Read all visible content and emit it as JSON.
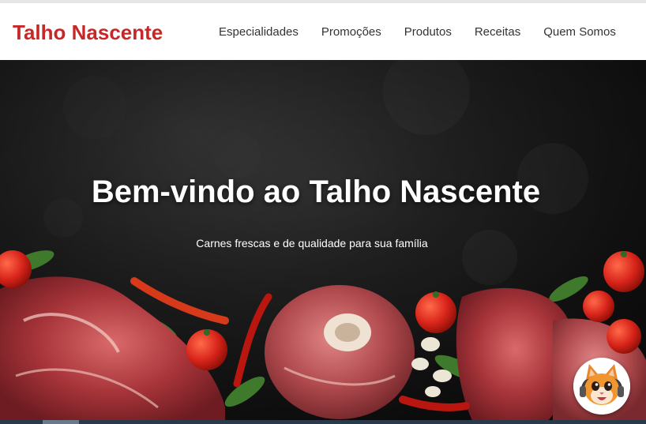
{
  "brand": {
    "name": "Talho Nascente",
    "color": "#c62828"
  },
  "nav": {
    "items": [
      {
        "label": "Especialidades"
      },
      {
        "label": "Promoções"
      },
      {
        "label": "Produtos"
      },
      {
        "label": "Receitas"
      },
      {
        "label": "Quem Somos"
      }
    ]
  },
  "hero": {
    "title": "Bem-vindo ao Talho Nascente",
    "subtitle": "Carnes frescas e de qualidade para sua família"
  },
  "chat_widget": {
    "icon": "cat-mascot-icon"
  }
}
